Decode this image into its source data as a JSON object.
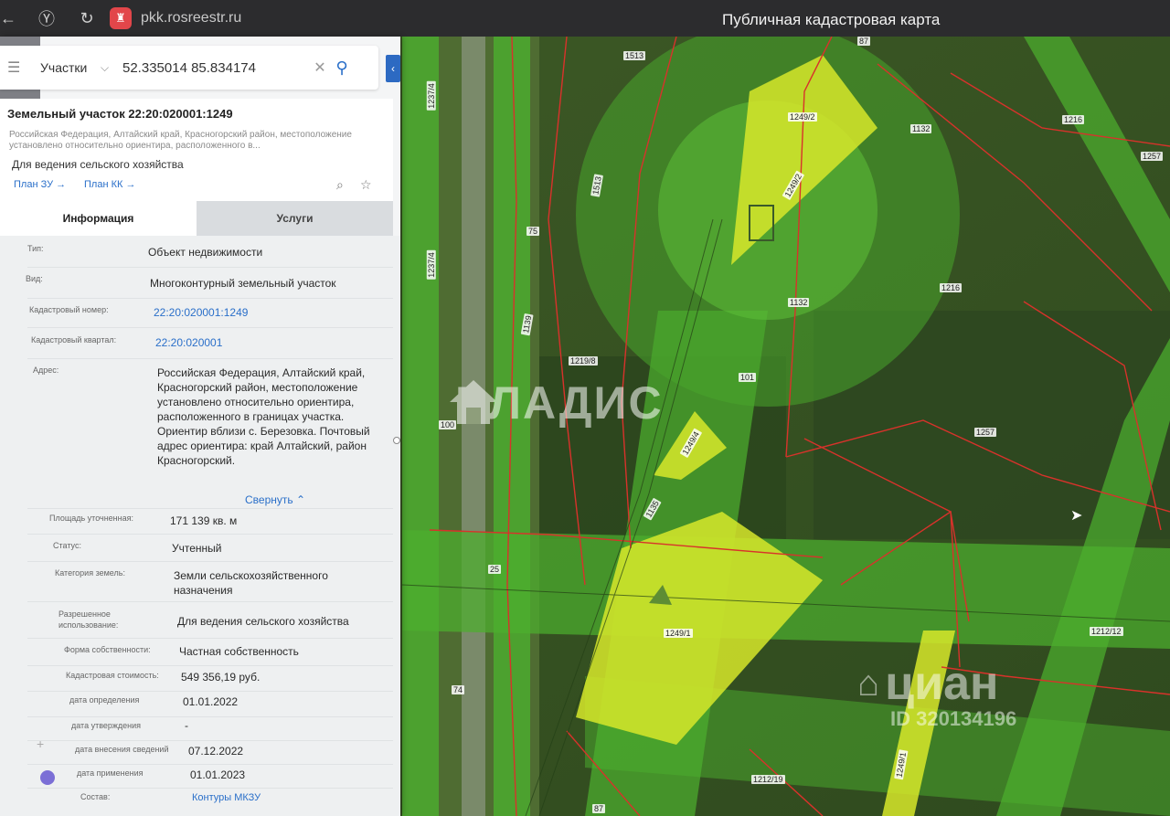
{
  "browser": {
    "url": "pkk.rosreestr.ru",
    "title": "Публичная кадастровая карта",
    "back_icon": "arrow-left-icon",
    "yandex_icon": "yandex-icon",
    "reload_icon": "reload-icon",
    "site_icon": "rosreestr-site-icon"
  },
  "search": {
    "type": "Участки",
    "query": "52.335014 85.834174"
  },
  "card": {
    "title": "Земельный участок 22:20:020001:1249",
    "address_short": "Российская Федерация, Алтайский край, Красногорский район, местоположение установлено относительно ориентира, расположенного в...",
    "use": "Для ведения сельского хозяйства",
    "plan_zu": "План ЗУ →",
    "plan_kk": "План КК →"
  },
  "tabs": [
    {
      "label": "Информация",
      "active": true
    },
    {
      "label": "Услуги",
      "active": false
    }
  ],
  "info": {
    "rows": [
      {
        "label": "Тип:",
        "value": "Объект недвижимости"
      },
      {
        "label": "Вид:",
        "value": "Многоконтурный земельный участок"
      },
      {
        "label": "Кадастровый номер:",
        "value": "22:20:020001:1249"
      },
      {
        "label": "Кадастровый квартал:",
        "value": "22:20:020001"
      },
      {
        "label": "Адрес:",
        "value": "Российская Федерация, Алтайский край, Красногорский район, местоположение установлено относительно ориентира, расположенного в границах участка. Ориентир вблизи с. Березовка. Почтовый адрес ориентира: край Алтайский, район Красногорский."
      },
      {
        "label": "Площадь уточненная:",
        "value": "171 139 кв. м"
      },
      {
        "label": "Статус:",
        "value": "Учтенный"
      },
      {
        "label": "Категория земель:",
        "value": "Земли сельскохозяйственного назначения"
      },
      {
        "label": "Разрешенное использование:",
        "value": "Для ведения сельского хозяйства"
      },
      {
        "label": "Форма собственности:",
        "value": "Частная собственность"
      },
      {
        "label": "Кадастровая стоимость:",
        "value": "549 356,19 руб."
      },
      {
        "label": "дата определения",
        "value": "01.01.2022"
      },
      {
        "label": "дата утверждения",
        "value": "-"
      },
      {
        "label": "дата внесения сведений",
        "value": "07.12.2022"
      },
      {
        "label": "дата применения",
        "value": "01.01.2023"
      },
      {
        "label": "Состав:",
        "value": "Контуры МКЗУ"
      }
    ],
    "collapse_label": "Свернуть"
  },
  "map": {
    "labels": [
      "87",
      "1513",
      "1237/4",
      "1249/2",
      "1132",
      "1216",
      "1257",
      "1513",
      "1249/2",
      "75",
      "1139",
      "1237/4",
      "1216",
      "1132",
      "1219/8",
      "101",
      "100",
      "1249/4",
      "1257",
      "1135",
      "25",
      "1249/1",
      "1212/12",
      "74",
      "1249/1",
      "1212/19",
      "87"
    ],
    "colors": {
      "field_green": "#4caf2e",
      "highlight_yellow": "#d7e82a",
      "boundary_red": "#d8322b"
    }
  },
  "watermarks": {
    "vladis": "ВЛАДИС",
    "cian": "циан",
    "cian_id": "ID 320134196"
  }
}
